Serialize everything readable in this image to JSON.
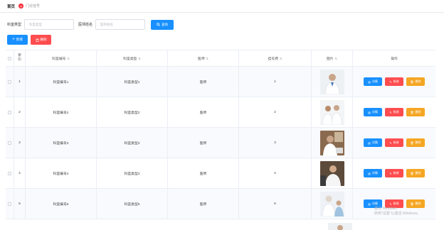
{
  "breadcrumb": {
    "home": "首页",
    "badge": "@",
    "current": "门诊挂号"
  },
  "filters": [
    {
      "label": "科室类型",
      "placeholder": "科室类型"
    },
    {
      "label": "医师姓名",
      "placeholder": "医师姓名"
    }
  ],
  "search_label": "查询",
  "actions": {
    "add_label": "新增",
    "delete_label": "删除"
  },
  "table": {
    "headers": {
      "index": "索引",
      "dept_no": "科室编号",
      "dept_type": "科室类型",
      "doctor": "医师",
      "number": "挂号费",
      "photo": "图片",
      "ops": "操作"
    },
    "rows": [
      {
        "index": "1",
        "dept_no": "科室编号1",
        "dept_type": "科室类型1",
        "doctor": "医师",
        "number": "1"
      },
      {
        "index": "2",
        "dept_no": "科室编号2",
        "dept_type": "科室类型2",
        "doctor": "医师",
        "number": "2"
      },
      {
        "index": "3",
        "dept_no": "科室编号3",
        "dept_type": "科室类型3",
        "doctor": "医师",
        "number": "3"
      },
      {
        "index": "4",
        "dept_no": "科室编号4",
        "dept_type": "科室类型4",
        "doctor": "医师",
        "number": "4"
      },
      {
        "index": "5",
        "dept_no": "科室编号5",
        "dept_type": "科室类型5",
        "doctor": "医师",
        "number": "5"
      }
    ],
    "row_buttons": {
      "detail": "详情",
      "edit": "修改",
      "delete": "删除"
    }
  },
  "watermark": {
    "line1": "激活 Windows",
    "line2": "转到\"设置\"以激活 Windows。"
  },
  "colors": {
    "primary": "#1890ff",
    "danger": "#ff4d4f",
    "warning": "#f5a623"
  }
}
